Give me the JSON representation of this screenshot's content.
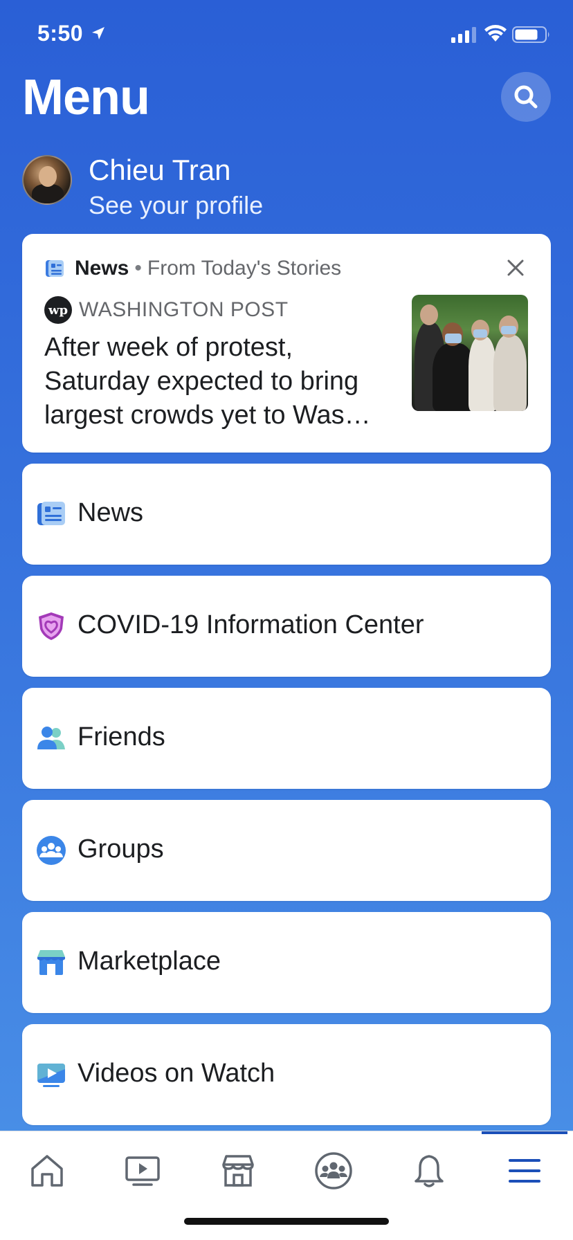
{
  "status": {
    "time": "5:50"
  },
  "header": {
    "title": "Menu"
  },
  "profile": {
    "name": "Chieu Tran",
    "subtitle": "See your profile"
  },
  "news_card": {
    "section": "News",
    "separator": "•",
    "from": "From Today's Stories",
    "publisher_logo": "wp",
    "publisher": "WASHINGTON POST",
    "headline": "After week of protest, Saturday expected to bring largest crowds yet to Was…"
  },
  "menu_items": [
    {
      "label": "News",
      "icon": "news-icon"
    },
    {
      "label": "COVID-19 Information Center",
      "icon": "covid-shield-icon"
    },
    {
      "label": "Friends",
      "icon": "friends-icon"
    },
    {
      "label": "Groups",
      "icon": "groups-icon"
    },
    {
      "label": "Marketplace",
      "icon": "marketplace-icon"
    },
    {
      "label": "Videos on Watch",
      "icon": "watch-icon"
    }
  ],
  "tab_bar": {
    "tabs": [
      "home-icon",
      "watch-tab-icon",
      "marketplace-tab-icon",
      "groups-tab-icon",
      "notifications-icon",
      "menu-icon"
    ],
    "active": "menu-icon"
  },
  "colors": {
    "accent": "#1b4fb8",
    "background_top": "#2a5fd6",
    "background_bottom": "#4c93e8"
  }
}
